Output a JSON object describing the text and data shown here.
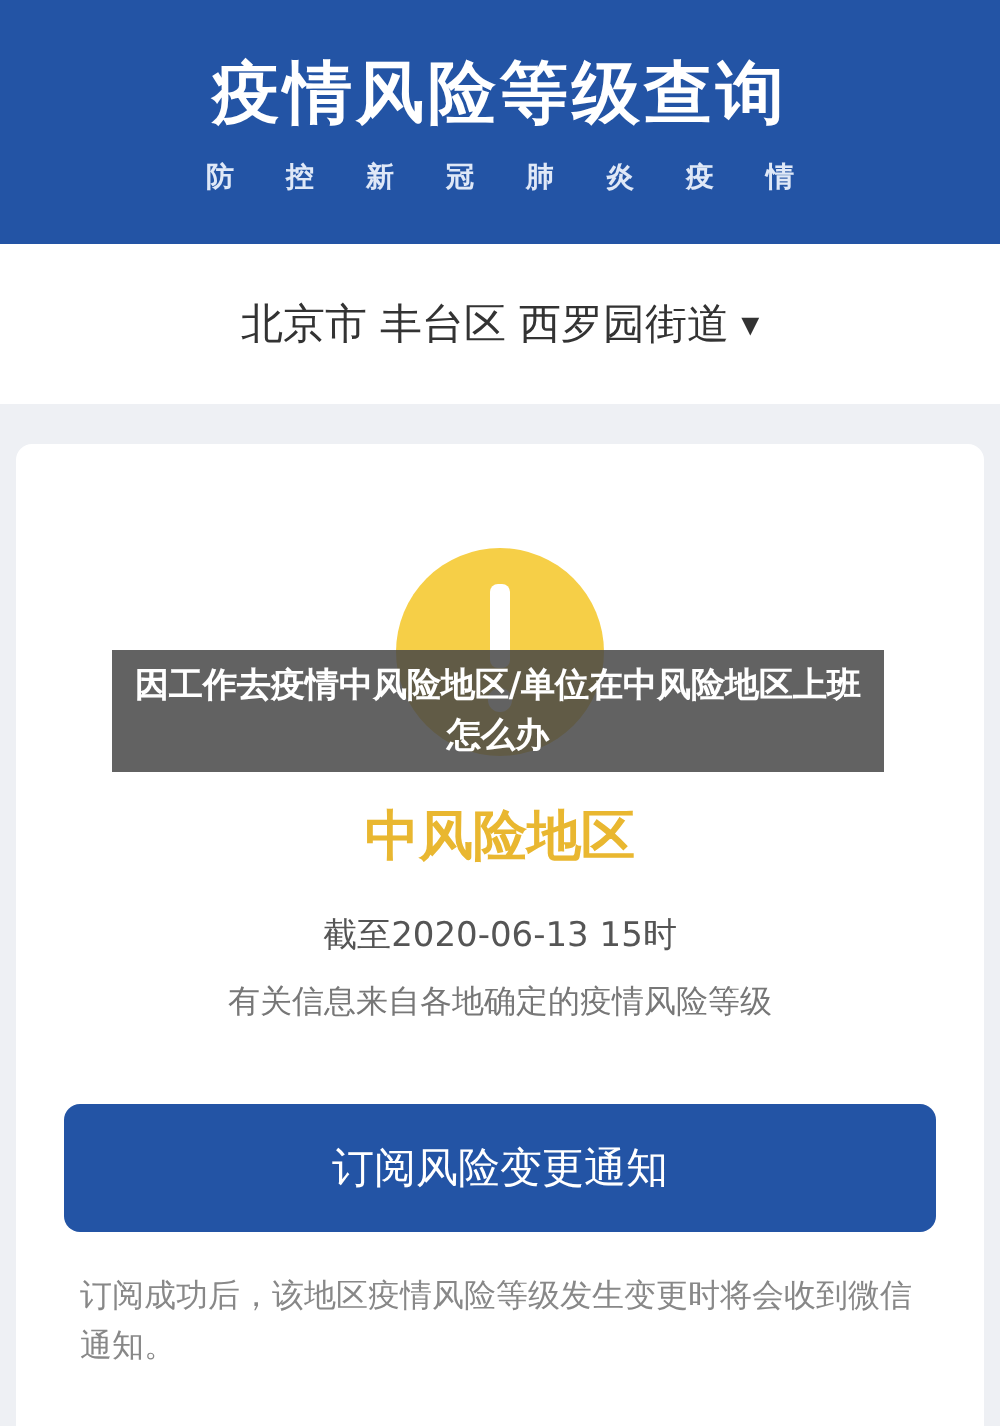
{
  "header": {
    "title": "疫情风险等级查询",
    "subtitle": [
      "防",
      "控",
      "新",
      "冠",
      "肺",
      "炎",
      "疫",
      "情"
    ]
  },
  "location": {
    "text": "北京市 丰台区 西罗园街道",
    "caret": "▾"
  },
  "result": {
    "level": "中风险地区",
    "time": "截至2020-06-13 15时",
    "source": "有关信息来自各地确定的疫情风险等级"
  },
  "subscribe_button": "订阅风险变更通知",
  "note": "订阅成功后，该地区疫情风险等级发生变更时将会收到微信通知。",
  "caption": "因工作去疫情中风险地区/单位在中风险地区上班怎么办"
}
